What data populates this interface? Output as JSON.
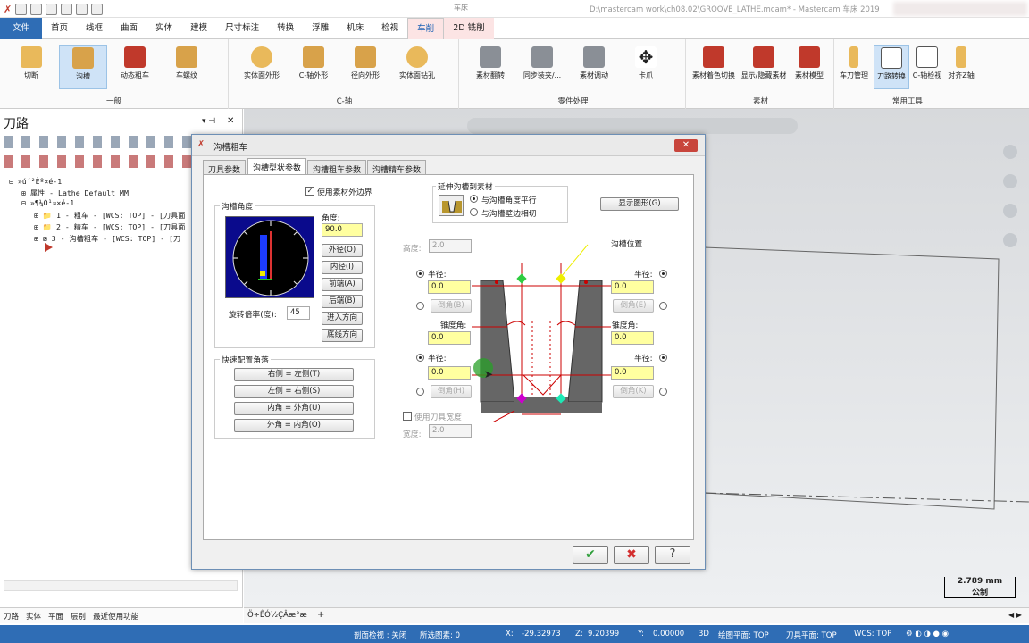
{
  "window": {
    "context_label": "车床",
    "title": "D:\\mastercam work\\ch08.02\\GROOVE_LATHE.mcam* - Mastercam 车床 2019"
  },
  "ribbon_tabs": [
    "文件",
    "首页",
    "线框",
    "曲面",
    "实体",
    "建模",
    "尺寸标注",
    "转换",
    "浮雕",
    "机床",
    "检视",
    "车削",
    "2D 铣削"
  ],
  "ribbon": {
    "groups": [
      {
        "label": "一般",
        "buttons": [
          "切断",
          "沟槽",
          "动态粗车",
          "车螺纹"
        ]
      },
      {
        "label": "C-轴",
        "buttons": [
          "实体面外形",
          "C-轴外形",
          "径向外形",
          "实体面钻孔"
        ]
      },
      {
        "label": "零件处理",
        "buttons": [
          "素材翻转",
          "同步装夹/...",
          "素材调动",
          "卡爪"
        ]
      },
      {
        "label": "素材",
        "buttons": [
          "素材着色切换",
          "显示/隐藏素材",
          "素材模型"
        ]
      },
      {
        "label": "常用工具",
        "buttons": [
          "车刀管理",
          "刀路转换",
          "C-轴检视",
          "对齐Z轴"
        ]
      }
    ]
  },
  "toolpath_panel": {
    "title": "刀路",
    "tree": [
      "»ú´²Èº×é-1",
      "属性 - Lathe Default MM",
      "»¶¼Ó¹¤×é-1",
      "1 - 粗车 - [WCS: TOP] - [刀具面",
      "2 - 精车 - [WCS: TOP] - [刀具面",
      "3 - 沟槽粗车 - [WCS: TOP] - [刀"
    ],
    "bottom_tabs": [
      "刀路",
      "实体",
      "平面",
      "层别",
      "最近使用功能"
    ]
  },
  "viewsheet": {
    "tab": "Ö÷ÊÓ½ÇÂæ°æ",
    "add": "+"
  },
  "scale": {
    "value": "2.789 mm",
    "unit": "公制"
  },
  "dialog": {
    "title": "沟槽粗车",
    "tabs": [
      "刀具参数",
      "沟槽型状参数",
      "沟槽粗车参数",
      "沟槽精车参数"
    ],
    "use_stock_boundary": "使用素材外边界",
    "groove_angle_label": "沟槽角度",
    "angle_label": "角度:",
    "angle_value": "90.0",
    "dir_buttons": [
      "外径(O)",
      "内径(I)",
      "前端(A)",
      "后端(B)",
      "进入方向(E)",
      "底线方向(L)"
    ],
    "rotate_label": "旋转倍率(度):",
    "rotate_value": "45",
    "quick_corner_label": "快速配置角落",
    "quick_buttons": [
      "右侧 = 左侧(T)",
      "左侧 = 右侧(S)",
      "内角 = 外角(U)",
      "外角 = 内角(O)"
    ],
    "extend_label": "延伸沟槽到素材",
    "extend_opt1": "与沟槽角度平行",
    "extend_opt2": "与沟槽壁边相切",
    "show_graphic": "显示图形(G)",
    "height_label": "高度:",
    "height_value": "2.0",
    "groove_pos_label": "沟槽位置",
    "radius_label": "半径:",
    "chamfer_label": "倒角(B)",
    "chamfer_label_b": "倒角(E)",
    "chamfer_label_c": "倒角(H)",
    "chamfer_label_d": "倒角(K)",
    "taper_label": "锥度角:",
    "field_values": [
      "0.0",
      "0.0",
      "0.0",
      "0.0",
      "0.0",
      "0.0"
    ],
    "use_tool_width": "使用刀具宽度",
    "width_label": "宽度:",
    "width_value": "2.0"
  },
  "status": {
    "section_view": "剖面检视 : 关闭",
    "selected": "所选图素: 0",
    "x_label": "X:",
    "x": "-29.32973",
    "z_label": "Z:",
    "z": "9.20399",
    "y_label": "Y:",
    "y": "0.00000",
    "mode": "3D",
    "cplane": "绘图平面: TOP",
    "tplane": "刀具平面: TOP",
    "wcs": "WCS: TOP"
  }
}
